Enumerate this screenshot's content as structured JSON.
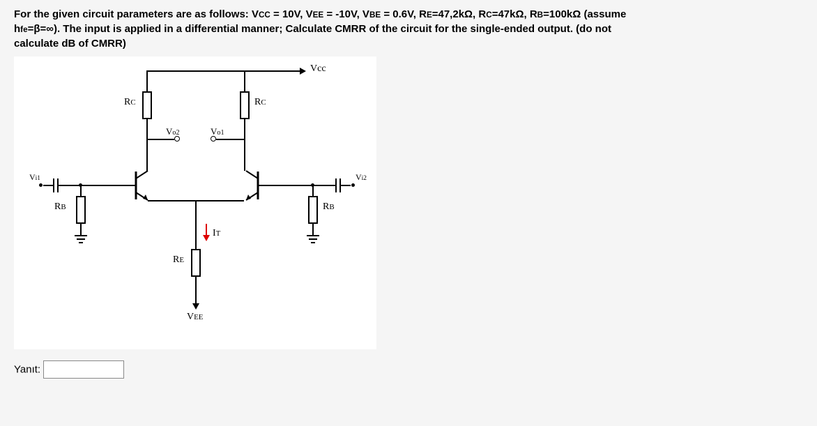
{
  "question": {
    "line1a": "For the given circuit parameters are as follows: V",
    "cc": "CC",
    "eq1": " = 10V, V",
    "ee": "EE",
    "eq2": " = -10V, V",
    "be": "BE",
    "eq3": " = 0.6V, R",
    "re_s": "E",
    "eq4": "=47,2kΩ, R",
    "rc_s": "C",
    "eq5": "=47kΩ, R",
    "rb_s": "B",
    "eq6": "=100kΩ (assume",
    "line2a": "h",
    "hfe": "fe",
    "line2b": "=β=∞).  The input is applied in a differential manner;  Calculate CMRR of the circuit for the single-ended output. (do not",
    "line3": "calculate dB of CMRR)"
  },
  "labels": {
    "vcc": "Vcc",
    "rc1": "R",
    "rc1s": "C",
    "rc2": "R",
    "rc2s": "C",
    "vo1": "V",
    "vo1s": "o1",
    "vo2": "V",
    "vo2s": "o2",
    "vi1": "V",
    "vi1s": "i1",
    "vi2": "V",
    "vi2s": "i2",
    "rb1": "R",
    "rb1s": "B",
    "rb2": "R",
    "rb2s": "B",
    "it": "I",
    "its": "T",
    "re": "R",
    "res": "E",
    "vee": "V",
    "vees": "EE"
  },
  "answer": {
    "label": "Yanıt:",
    "value": ""
  }
}
